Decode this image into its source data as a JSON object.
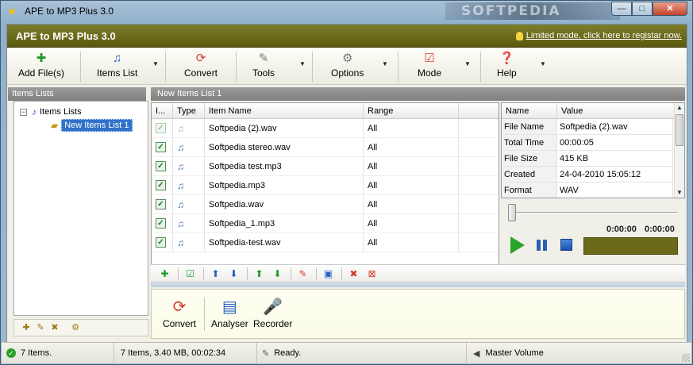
{
  "window": {
    "title": "APE to MP3 Plus 3.0",
    "watermark": "SOFTPEDIA",
    "controls": {
      "minimize": "—",
      "maximize": "□",
      "close": "✕"
    }
  },
  "header": {
    "app_name": "APE to MP3 Plus 3.0",
    "register_link": "Limited mode, click here to registar now."
  },
  "toolbar": {
    "add": "Add File(s)",
    "items_list": "Items List",
    "convert": "Convert",
    "tools": "Tools",
    "options": "Options",
    "mode": "Mode",
    "help": "Help"
  },
  "left_panel": {
    "heading": "Items Lists",
    "root": "Items Lists",
    "selected": "New Items List 1"
  },
  "content": {
    "heading": "New Items List 1",
    "columns": [
      "I...",
      "Type",
      "Item Name",
      "Range"
    ],
    "rows": [
      {
        "name": "Softpedia (2).wav",
        "range": "All"
      },
      {
        "name": "Softpedia stereo.wav",
        "range": "All"
      },
      {
        "name": "Softpedia test.mp3",
        "range": "All"
      },
      {
        "name": "Softpedia.mp3",
        "range": "All"
      },
      {
        "name": "Softpedia.wav",
        "range": "All"
      },
      {
        "name": "Softpedia_1.mp3",
        "range": "All"
      },
      {
        "name": "Softpedia-test.wav",
        "range": "All"
      }
    ]
  },
  "properties": {
    "columns": [
      "Name",
      "Value"
    ],
    "rows": [
      {
        "k": "File Name",
        "v": "Softpedia (2).wav"
      },
      {
        "k": "Total Time",
        "v": "00:00:05"
      },
      {
        "k": "File Size",
        "v": "415 KB"
      },
      {
        "k": "Created",
        "v": "24-04-2010 15:05:12"
      },
      {
        "k": "Format",
        "v": "WAV"
      }
    ]
  },
  "player": {
    "position": 0,
    "elapsed": "0:00:00",
    "total": "0:00:00"
  },
  "bottom_tools": {
    "convert": "Convert",
    "analyser": "Analyser",
    "recorder": "Recorder"
  },
  "status": {
    "items": "7 Items.",
    "summary": "7 Items, 3.40 MB, 00:02:34",
    "state": "Ready.",
    "volume": "Master Volume"
  },
  "colors": {
    "header": "#6b6b1c",
    "selection": "#3072c8",
    "check": "#1c7a1c"
  }
}
